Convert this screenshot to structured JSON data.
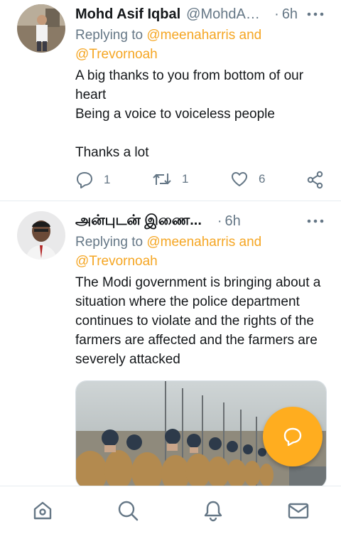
{
  "tweets": [
    {
      "name": "Mohd Asif Iqbal",
      "handle": "@MohdAsifIqbal",
      "dot": "·",
      "time": "6h",
      "replying_prefix": "Replying to ",
      "replying_to_1": "@meenaharris",
      "replying_and": " and",
      "replying_to_2": "@Trevornoah",
      "text": "A big thanks to you from bottom of our heart\nBeing a voice to voiceless people\n\nThanks a lot",
      "reply_count": "1",
      "retweet_count": "1",
      "like_count": "6"
    },
    {
      "name": "அன்புடன் இணை...",
      "dot": "·",
      "time": "6h",
      "replying_prefix": "Replying to ",
      "replying_to_1": "@meenaharris",
      "replying_and": " and",
      "replying_to_2": "@Trevornoah",
      "text": "The Modi government is bringing about a situation where the police department continues to violate and the rights of the farmers are affected and the farmers are severely attacked"
    }
  ],
  "more_icon": "more-horizontal-icon",
  "compose_icon": "compose-reply-icon",
  "tabs": [
    "home-icon",
    "search-icon",
    "notifications-icon",
    "messages-icon"
  ],
  "colors": {
    "accent": "#ffad1f",
    "link": "#f5a623",
    "muted": "#657786"
  }
}
